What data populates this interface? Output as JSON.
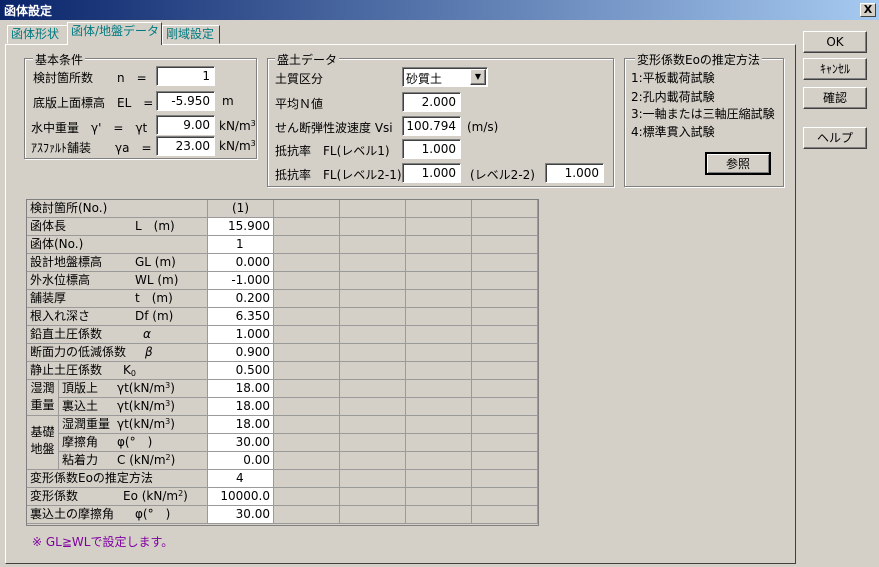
{
  "window": {
    "title": "函体設定",
    "close_glyph": "X"
  },
  "tabs": [
    {
      "label": "函体形状"
    },
    {
      "label": "函体/地盤データ"
    },
    {
      "label": "剛域設定"
    }
  ],
  "buttons": {
    "ok": "OK",
    "cancel": "ｷｬﾝｾﾙ",
    "confirm": "確認",
    "help": "ヘルプ"
  },
  "basic": {
    "title": "基本条件",
    "count_label": "検討箇所数　　n　=",
    "count_value": "1",
    "el_label": "底版上面標高　EL　=",
    "el_value": "-5.950",
    "el_unit": "m",
    "water_label": "水中重量　γ'　=　γt　-",
    "water_value": "9.00",
    "water_unit": "kN/m",
    "asphalt_label": "ｱｽﾌｧﾙﾄ舗装　　γa　=",
    "asphalt_value": "23.00",
    "asphalt_unit": "kN/m",
    "sup3": "3"
  },
  "embank": {
    "title": "盛土データ",
    "soil_label": "土質区分",
    "soil_value": "砂質土",
    "n_label": "平均Ｎ値",
    "n_value": "2.000",
    "vs_label": "せん断弾性波速度 Vsi",
    "vs_value": "100.794",
    "vs_unit": "(m/s)",
    "fl1_label": "抵抗率　FL(レベル1)",
    "fl1_value": "1.000",
    "fl21_label": "抵抗率　FL(レベル2-1)",
    "fl21_value": "1.000",
    "fl22_label": "(レベル2-2)",
    "fl22_value": "1.000"
  },
  "eo": {
    "title": "変形係数Eoの推定方法",
    "items": [
      "1:平板載荷試験",
      "2:孔内載荷試験",
      "3:一軸または三軸圧縮試験",
      "4:標準貫入試験"
    ],
    "ref_button": "参照"
  },
  "grid": {
    "header": {
      "caption": "検討箇所(No.)",
      "col1": "(1)"
    },
    "rows": {
      "length": {
        "label": "函体長",
        "sym": "L　(m)",
        "value": "15.900"
      },
      "body_no": {
        "label": "函体(No.)",
        "value": "1"
      },
      "gl": {
        "label": "設計地盤標高",
        "sym": "GL (m)",
        "value": "0.000"
      },
      "wl": {
        "label": "外水位標高",
        "sym": "WL (m)",
        "value": "-1.000"
      },
      "pave": {
        "label": "舗装厚",
        "sym": "t　(m)",
        "value": "0.200"
      },
      "df": {
        "label": "根入れ深さ",
        "sym": "Df (m)",
        "value": "6.350"
      },
      "alpha": {
        "label": "鉛直土圧係数",
        "sym": "α",
        "value": "1.000"
      },
      "beta": {
        "label": "断面力の低減係数",
        "sym": "β",
        "value": "0.900"
      },
      "k0": {
        "label": "静止土圧係数",
        "sym": "K",
        "sub": "0",
        "value": "0.500"
      },
      "wet_group": "湿潤\n重量",
      "wet_top": {
        "label": "頂版上",
        "sym": "γt(kN/m",
        "value": "18.00"
      },
      "wet_back": {
        "label": "裏込土",
        "sym": "γt(kN/m",
        "value": "18.00"
      },
      "base_group": "基礎\n地盤",
      "base_wet": {
        "label": "湿潤重量",
        "sym": "γt(kN/m",
        "value": "18.00"
      },
      "base_phi": {
        "label": "摩擦角",
        "sym": "φ(°　)",
        "value": "30.00"
      },
      "base_c": {
        "label": "粘着力",
        "sym": "C (kN/m",
        "value": "0.00"
      },
      "eo_method": {
        "label": "変形係数Eoの推定方法",
        "value": "4"
      },
      "eo": {
        "label": "変形係数",
        "sym": "Eo (kN/m",
        "value": "10000.0"
      },
      "back_phi": {
        "label": "裏込土の摩擦角",
        "sym": "φ(°　)",
        "value": "30.00"
      },
      "sup3": "3",
      "sup2": "2",
      "close_paren": ")"
    }
  },
  "note": "※ GL≧WLで設定します。",
  "colors": {
    "titlebar_start": "#0a246a",
    "titlebar_end": "#a6caf0",
    "tab_text": "#007a80",
    "note_text": "#8000a0"
  }
}
